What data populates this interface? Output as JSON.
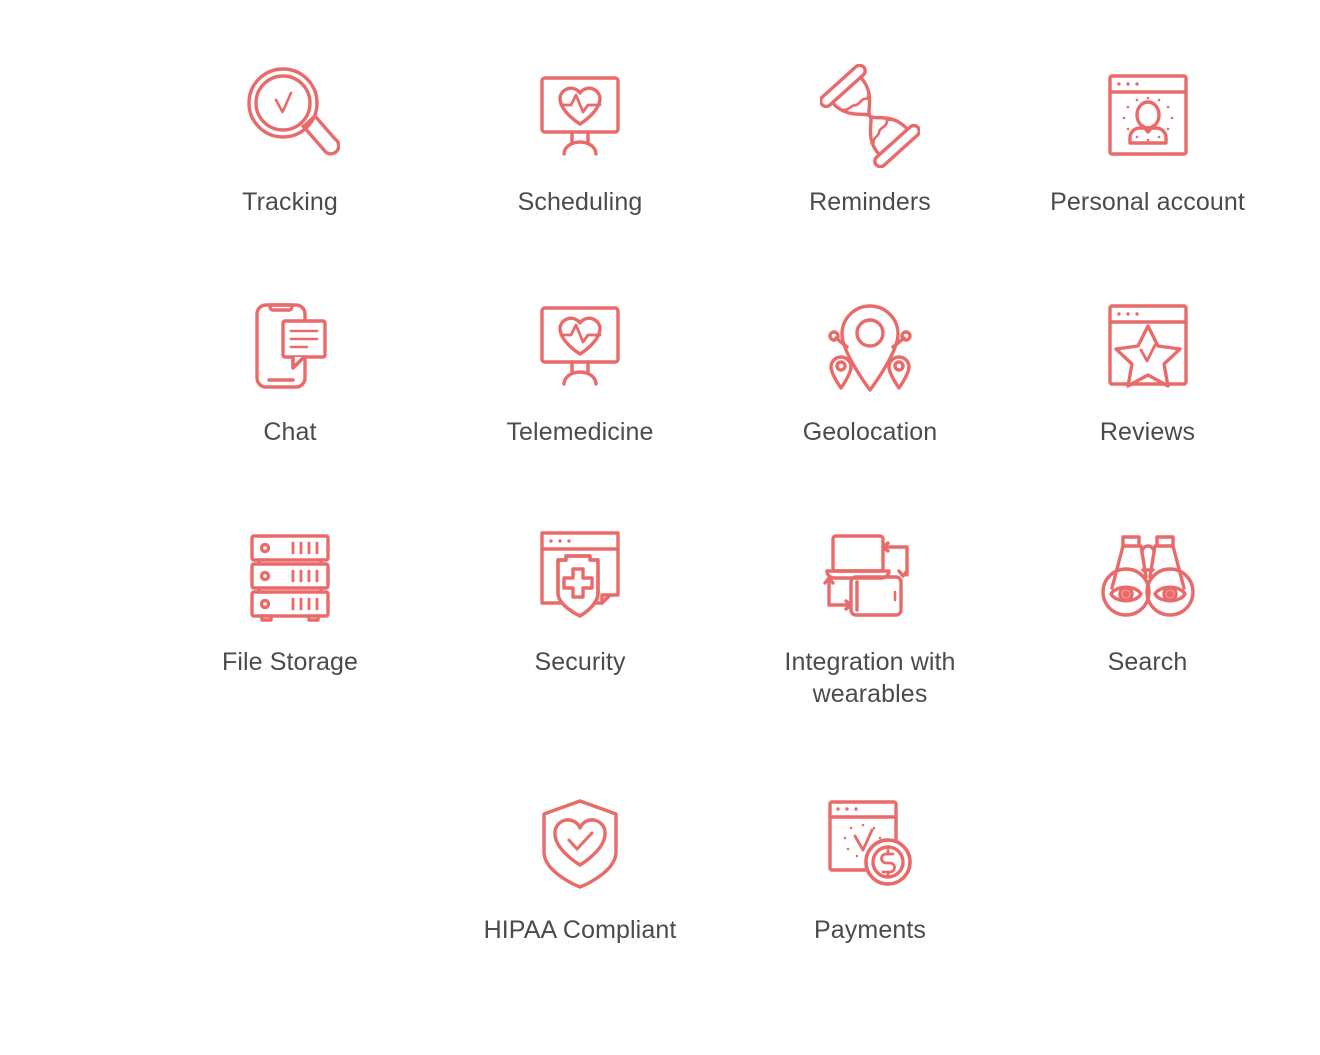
{
  "theme": {
    "accent_color": "#ea6a6a",
    "label_color": "#4a4b4d",
    "background_color": "#ffffff"
  },
  "features": [
    {
      "id": "tracking",
      "label": "Tracking",
      "icon": "magnifier-check-icon",
      "row": 1,
      "col": 1
    },
    {
      "id": "scheduling",
      "label": "Scheduling",
      "icon": "monitor-heartbeat-icon",
      "row": 1,
      "col": 2
    },
    {
      "id": "reminders",
      "label": "Reminders",
      "icon": "hourglass-icon",
      "row": 1,
      "col": 3
    },
    {
      "id": "personal-account",
      "label": "Personal account",
      "icon": "browser-user-icon",
      "row": 1,
      "col": 4
    },
    {
      "id": "chat",
      "label": "Chat",
      "icon": "phone-chat-bubble-icon",
      "row": 2,
      "col": 1
    },
    {
      "id": "telemedicine",
      "label": "Telemedicine",
      "icon": "monitor-heartbeat-icon",
      "row": 2,
      "col": 2
    },
    {
      "id": "geolocation",
      "label": "Geolocation",
      "icon": "map-pins-icon",
      "row": 2,
      "col": 3
    },
    {
      "id": "reviews",
      "label": "Reviews",
      "icon": "browser-star-check-icon",
      "row": 2,
      "col": 4
    },
    {
      "id": "file-storage",
      "label": "File Storage",
      "icon": "server-rack-icon",
      "row": 3,
      "col": 1
    },
    {
      "id": "security",
      "label": "Security",
      "icon": "browser-shield-cross-icon",
      "row": 3,
      "col": 2
    },
    {
      "id": "integration-with-wearables",
      "label": "Integration with wearables",
      "icon": "laptop-tablet-sync-icon",
      "row": 3,
      "col": 3
    },
    {
      "id": "search",
      "label": "Search",
      "icon": "binoculars-eyes-icon",
      "row": 3,
      "col": 4
    },
    {
      "id": "hipaa-compliant",
      "label": "HIPAA Compliant",
      "icon": "shield-heart-check-icon",
      "row": 4,
      "col": 2
    },
    {
      "id": "payments",
      "label": "Payments",
      "icon": "browser-coin-check-icon",
      "row": 4,
      "col": 3
    }
  ]
}
